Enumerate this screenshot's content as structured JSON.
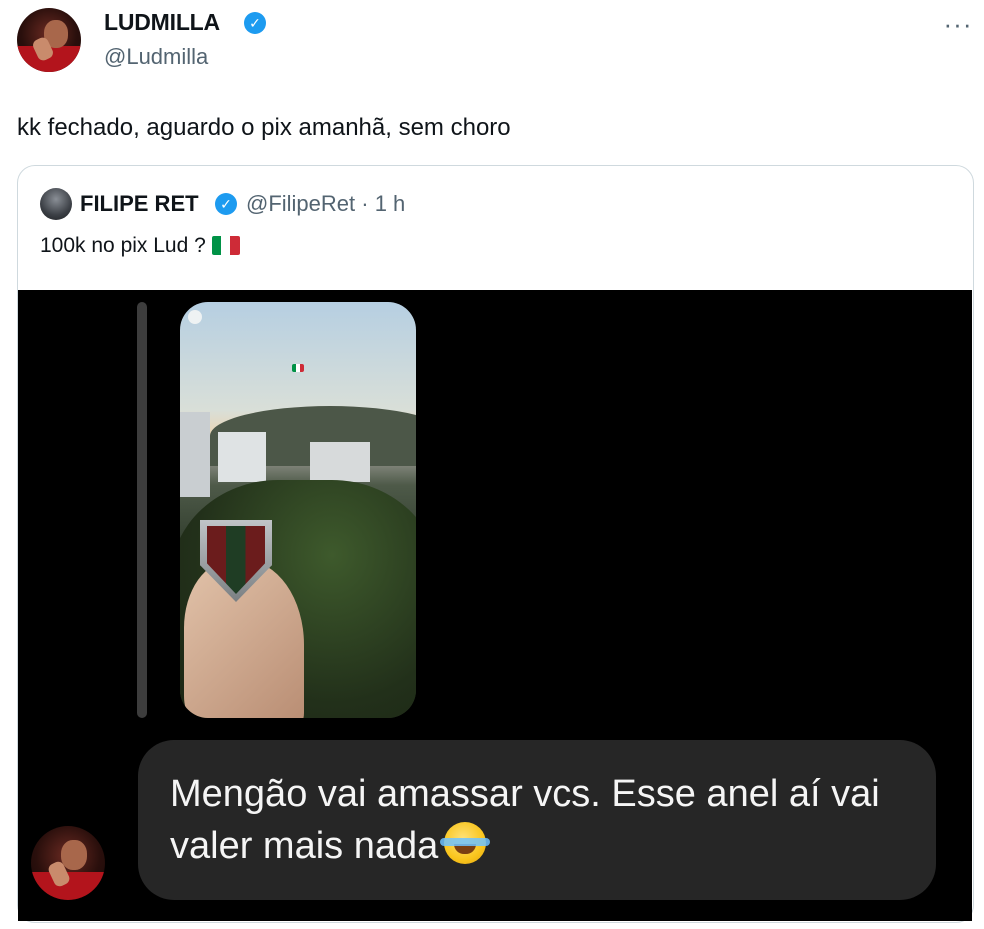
{
  "author": {
    "display_name": "LUDMILLA",
    "handle": "@Ludmilla",
    "verified": true
  },
  "more_icon": "···",
  "tweet": {
    "text": "kk fechado, aguardo o pix amanhã, sem choro"
  },
  "quoted_tweet": {
    "display_name": "FILIPE RET",
    "handle_time": "@FilipeRet · 1 h",
    "verified": true,
    "text": "100k no pix Lud ?",
    "flag": "italy-flag"
  },
  "media": {
    "reply_text": "Mengão vai amassar vcs. Esse anel aí vai valer mais nada",
    "reply_emoji": "tears-of-joy-emoji"
  },
  "colors": {
    "verified_blue": "#1d9bf0",
    "secondary_text": "#536471",
    "card_border": "#cfd9de",
    "bubble_bg": "#262626"
  }
}
